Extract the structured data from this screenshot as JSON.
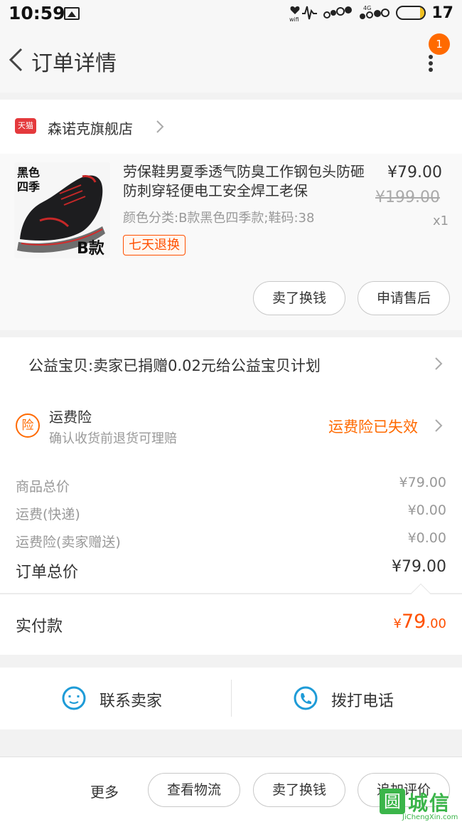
{
  "status_bar": {
    "time": "10:59",
    "battery_level": "17",
    "battery_fraction": 0.17,
    "network_label": "4G",
    "wifi_label": "wifi"
  },
  "header": {
    "title": "订单详情",
    "notification_count": "1"
  },
  "shop": {
    "platform_badge": "天猫",
    "name": "森诺克旗舰店"
  },
  "product": {
    "title": "劳保鞋男夏季透气防臭工作钢包头防砸防刺穿轻便电工安全焊工老保",
    "price": "¥79.00",
    "original_price": "¥199.00",
    "sku": "颜色分类:B款黑色四季款;鞋码:38",
    "quantity": "x1",
    "tag": "七天退换",
    "image_label_top": "黑色\n四季",
    "image_label_top_1": "黑色",
    "image_label_top_2": "四季",
    "image_label_bottom": "B款",
    "sell_button": "卖了换钱",
    "aftersale_button": "申请售后"
  },
  "charity": {
    "text": "公益宝贝:卖家已捐赠0.02元给公益宝贝计划"
  },
  "insurance": {
    "icon_char": "险",
    "title": "运费险",
    "subtitle": "确认收货前退货可理赔",
    "status": "运费险已失效"
  },
  "summary": {
    "rows": [
      {
        "label": "商品总价",
        "value": "¥79.00"
      },
      {
        "label": "运费(快递)",
        "value": "¥0.00"
      },
      {
        "label": "运费险(卖家赠送)",
        "value": "¥0.00"
      }
    ],
    "total_label": "订单总价",
    "total_value": "¥79.00"
  },
  "paid": {
    "label": "实付款",
    "currency": "¥",
    "integer": "79",
    "decimal": ".00"
  },
  "contact": {
    "seller": "联系卖家",
    "phone": "拨打电话"
  },
  "bottom_bar": {
    "more": "更多",
    "logistics": "查看物流",
    "sell": "卖了换钱",
    "review": "追加评价"
  },
  "watermark": {
    "cn": "城信",
    "box_char": "圆",
    "en": "JiChengXin.com"
  },
  "colors": {
    "accent": "#ff5000",
    "insurance": "#ff6a00",
    "icon_blue": "#1e9bd7",
    "tmall_red": "#e4393c",
    "watermark_green": "#3bb54a"
  }
}
